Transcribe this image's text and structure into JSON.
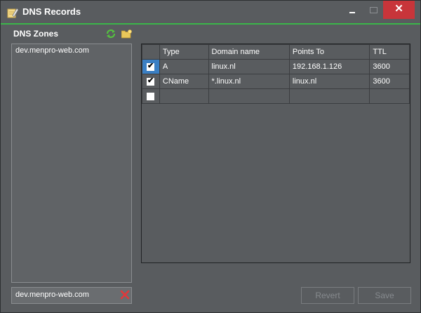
{
  "window": {
    "title": "DNS Records",
    "close_glyph": "✕"
  },
  "zones": {
    "label": "DNS Zones",
    "items": [
      "dev.menpro-web.com"
    ],
    "input_value": "dev.menpro-web.com"
  },
  "grid": {
    "columns": [
      "Type",
      "Domain name",
      "Points To",
      "TTL"
    ],
    "rows": [
      {
        "checked": true,
        "type": "A",
        "domain": "linux.nl",
        "points_to": "192.168.1.126",
        "ttl": "3600"
      },
      {
        "checked": true,
        "type": "CName",
        "domain": "*.linux.nl",
        "points_to": "linux.nl",
        "ttl": "3600"
      },
      {
        "checked": false,
        "type": "",
        "domain": "",
        "points_to": "",
        "ttl": ""
      }
    ],
    "check_glyph": "✔"
  },
  "actions": {
    "revert_label": "Revert",
    "save_label": "Save"
  },
  "colors": {
    "accent": "#3bb54a",
    "selection": "#3b7fc3",
    "close": "#c8353a",
    "clear_icon": "#e0393b"
  },
  "icons": [
    "app-edit-icon",
    "refresh-icon",
    "new-folder-icon",
    "clear-icon",
    "minimize-icon",
    "maximize-icon",
    "close-icon"
  ]
}
